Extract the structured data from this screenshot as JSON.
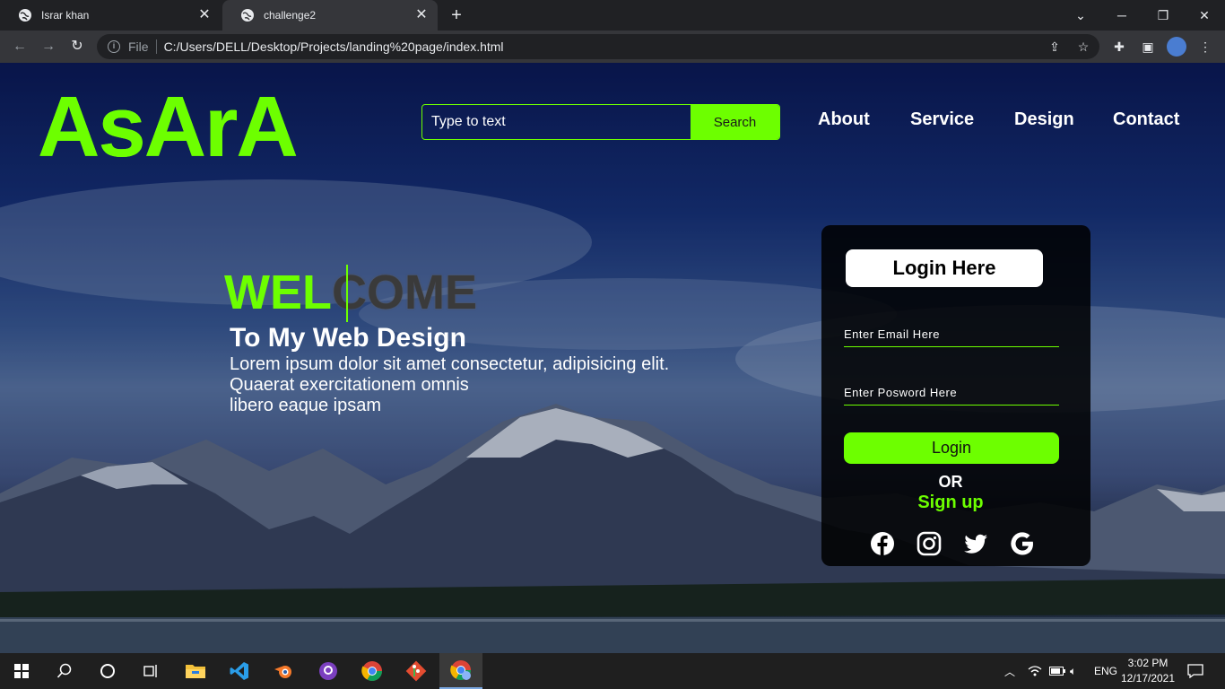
{
  "browser": {
    "tabs": [
      {
        "title": "Israr khan",
        "active": false
      },
      {
        "title": "challenge2",
        "active": true
      }
    ],
    "address": {
      "scheme_label": "File",
      "url": "C:/Users/DELL/Desktop/Projects/landing%20page/index.html"
    }
  },
  "site": {
    "logo": "AsArA",
    "search": {
      "placeholder": "Type to text",
      "button": "Search"
    },
    "nav": [
      "About",
      "Service",
      "Design",
      "Contact"
    ],
    "hero": {
      "welcome_typed": "WEL",
      "welcome_rest": "COME",
      "subtitle": "To My Web Design",
      "body_line1": "Lorem ipsum dolor sit amet consectetur, adipisicing elit.",
      "body_line2": "Quaerat exercitationem omnis",
      "body_line3": "libero eaque ipsam"
    },
    "login": {
      "title": "Login Here",
      "email_placeholder": "Enter Email Here",
      "password_placeholder": "Enter Posword Here",
      "button": "Login",
      "or_text": "OR",
      "signup_text": "Sign up",
      "social_icons": [
        "facebook-icon",
        "instagram-icon",
        "twitter-icon",
        "google-icon"
      ]
    },
    "colors": {
      "accent": "#6dff00",
      "panel": "#000000",
      "text": "#ffffff"
    }
  },
  "taskbar": {
    "apps": [
      "windows-start-icon",
      "search-icon",
      "cortana-icon",
      "task-view-icon",
      "file-explorer-icon",
      "vscode-icon",
      "blender-icon",
      "github-desktop-icon",
      "chrome-icon",
      "git-icon",
      "chrome-profile-icon"
    ],
    "language": "ENG",
    "time": "3:02 PM",
    "date": "12/17/2021"
  }
}
